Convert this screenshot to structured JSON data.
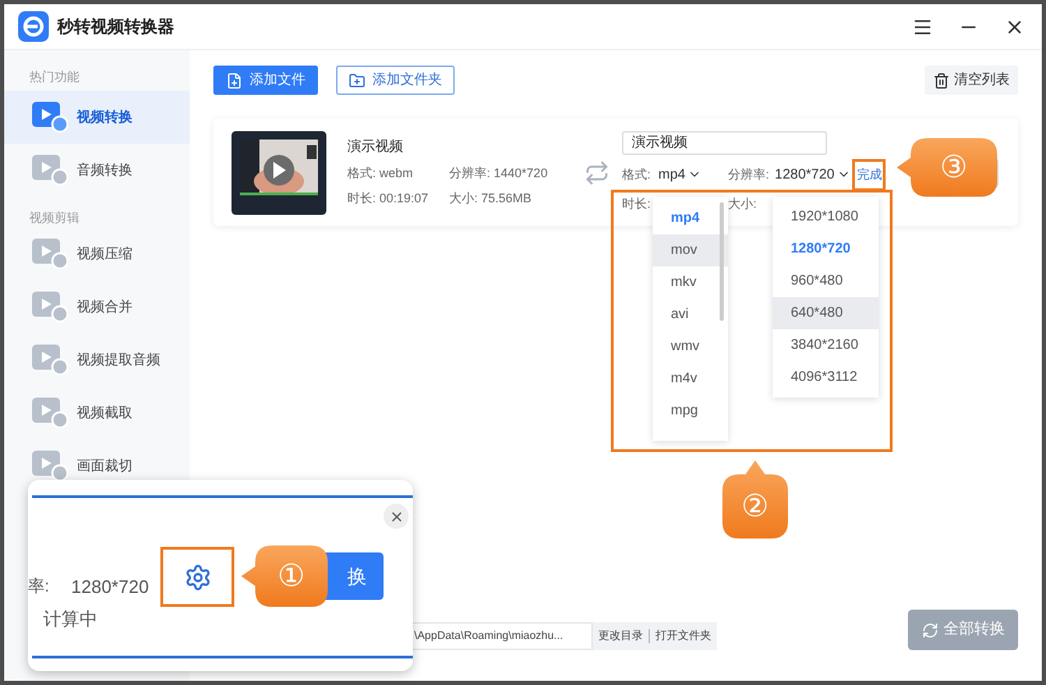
{
  "window": {
    "title": "秒转视频转换器"
  },
  "sidebar": {
    "sections": [
      {
        "title": "热门功能",
        "items": [
          {
            "label": "视频转换",
            "selected": true
          },
          {
            "label": "音频转换",
            "selected": false
          }
        ]
      },
      {
        "title": "视频剪辑",
        "items": [
          {
            "label": "视频压缩",
            "selected": false
          },
          {
            "label": "视频合并",
            "selected": false
          },
          {
            "label": "视频提取音频",
            "selected": false
          },
          {
            "label": "视频截取",
            "selected": false
          },
          {
            "label": "画面裁切",
            "selected": false
          }
        ]
      }
    ]
  },
  "toolbar": {
    "add_file": "添加文件",
    "add_folder": "添加文件夹",
    "clear_list": "清空列表"
  },
  "file": {
    "name": "演示视频",
    "format_label": "格式:",
    "format": "webm",
    "resolution_label": "分辨率:",
    "resolution": "1440*720",
    "duration_label": "时长:",
    "duration": "00:19:07",
    "size_label": "大小:",
    "size": "75.56MB",
    "output_name": "演示视频",
    "out_format_label": "格式:",
    "out_format": "mp4",
    "out_resolution_label": "分辨率:",
    "out_resolution": "1280*720",
    "done": "完成",
    "out_duration_label": "时长:",
    "out_size_label": "大小:"
  },
  "format_options": [
    {
      "label": "mp4",
      "selected": true,
      "hover": false
    },
    {
      "label": "mov",
      "selected": false,
      "hover": true
    },
    {
      "label": "mkv",
      "selected": false,
      "hover": false
    },
    {
      "label": "avi",
      "selected": false,
      "hover": false
    },
    {
      "label": "wmv",
      "selected": false,
      "hover": false
    },
    {
      "label": "m4v",
      "selected": false,
      "hover": false
    },
    {
      "label": "mpg",
      "selected": false,
      "hover": false
    }
  ],
  "resolution_options": [
    {
      "label": "1920*1080",
      "selected": false,
      "hover": false
    },
    {
      "label": "1280*720",
      "selected": true,
      "hover": false
    },
    {
      "label": "960*480",
      "selected": false,
      "hover": false
    },
    {
      "label": "640*480",
      "selected": false,
      "hover": true
    },
    {
      "label": "3840*2160",
      "selected": false,
      "hover": false
    },
    {
      "label": "4096*3112",
      "selected": false,
      "hover": false
    }
  ],
  "output_bar": {
    "path": "\\AppData\\Roaming\\miaozhu...",
    "change_dir": "更改目录",
    "open_folder": "打开文件夹",
    "convert_all": "全部转换"
  },
  "inset": {
    "rate_label": "率:",
    "resolution": "1280*720",
    "status": "计算中",
    "button": "换"
  },
  "callouts": [
    "①",
    "②",
    "③"
  ]
}
